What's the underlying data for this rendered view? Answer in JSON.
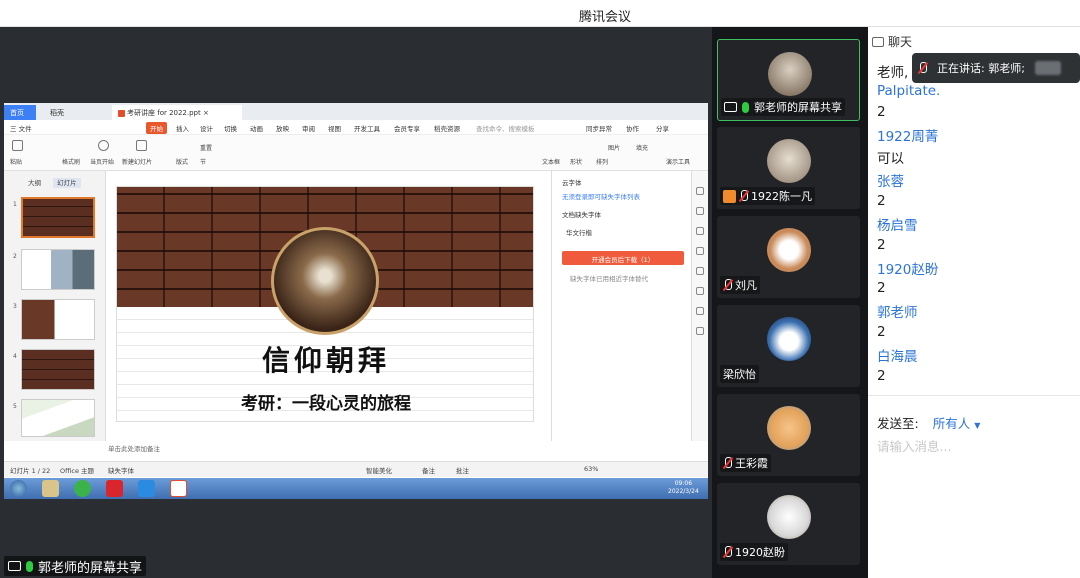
{
  "app": {
    "title": "腾讯会议"
  },
  "share_label": "郭老师的屏幕共享",
  "shared_window": {
    "tabs": [
      "首页",
      "稻壳",
      "考研讲座 for 2022.ppt"
    ],
    "menu": [
      "三 文件",
      "开始",
      "插入",
      "设计",
      "切换",
      "动画",
      "放映",
      "审阅",
      "视图",
      "开发工具",
      "会员专享",
      "稻壳资源",
      "查找命令、搜索模板",
      "同步异常",
      "协作",
      "分享"
    ],
    "toolbar": [
      "粘贴",
      "格式刷",
      "当页开始",
      "新建幻灯片",
      "版式",
      "节",
      "重置",
      "文本框",
      "形状",
      "排列",
      "图片",
      "填充",
      "演示工具"
    ],
    "thumbs_tabs": [
      "大纲",
      "幻灯片"
    ],
    "thumb_numbers": [
      "1",
      "2",
      "3",
      "4",
      "5"
    ],
    "slide": {
      "calligraphy": "信仰朝拜",
      "subtitle": "考研：一段心灵的旅程"
    },
    "notes_placeholder": "单击此处添加备注",
    "right_panel": {
      "title": "云字体",
      "hint": "无须登录即可缺失字体列表",
      "section": "文档缺失字体",
      "font": "华文行楷",
      "button": "开通会员后下载（1）",
      "footnote": "缺失字体已用相近字体替代"
    },
    "status": {
      "slide_count": "幻灯片 1 / 22",
      "theme": "Office 主题",
      "font_missing": "缺失字体",
      "smart": "智能美化",
      "notes": "备注",
      "comment": "批注",
      "zoom": "63%"
    },
    "clock": {
      "time": "09:06",
      "date": "2022/3/24"
    }
  },
  "participants": [
    {
      "name": "郭老师的屏幕共享",
      "type": "share",
      "avatar_color": "#6d5a48"
    },
    {
      "name": "1922陈一凡",
      "type": "host",
      "avatar_color": "#8a7a6a"
    },
    {
      "name": "刘凡",
      "type": "muted",
      "avatar_color": "#c98a5a"
    },
    {
      "name": "梁欣怡",
      "type": "plain",
      "avatar_color": "#3a6fb0"
    },
    {
      "name": "王彩霞",
      "type": "muted",
      "avatar_color": "#e3a25a"
    },
    {
      "name": "1920赵盼",
      "type": "muted",
      "avatar_color": "#d8d8d8"
    }
  ],
  "chat": {
    "header": "聊天",
    "speaking": "正在讲话: 郭老师;",
    "messages": [
      {
        "kind": "text",
        "value": "老师,"
      },
      {
        "kind": "name",
        "value": "Palpitate."
      },
      {
        "kind": "text",
        "value": "2"
      },
      {
        "kind": "name",
        "value": "1922周菁"
      },
      {
        "kind": "text",
        "value": "可以"
      },
      {
        "kind": "name",
        "value": "张蓉"
      },
      {
        "kind": "text",
        "value": "2"
      },
      {
        "kind": "name",
        "value": "杨启雪"
      },
      {
        "kind": "text",
        "value": "2"
      },
      {
        "kind": "name",
        "value": "1920赵盼"
      },
      {
        "kind": "text",
        "value": "2"
      },
      {
        "kind": "name",
        "value": "郭老师"
      },
      {
        "kind": "text",
        "value": "2"
      },
      {
        "kind": "name",
        "value": "白海晨"
      },
      {
        "kind": "text",
        "value": "2"
      }
    ],
    "send_to_label": "发送至:",
    "send_to_value": "所有人",
    "input_placeholder": "请输入消息..."
  }
}
